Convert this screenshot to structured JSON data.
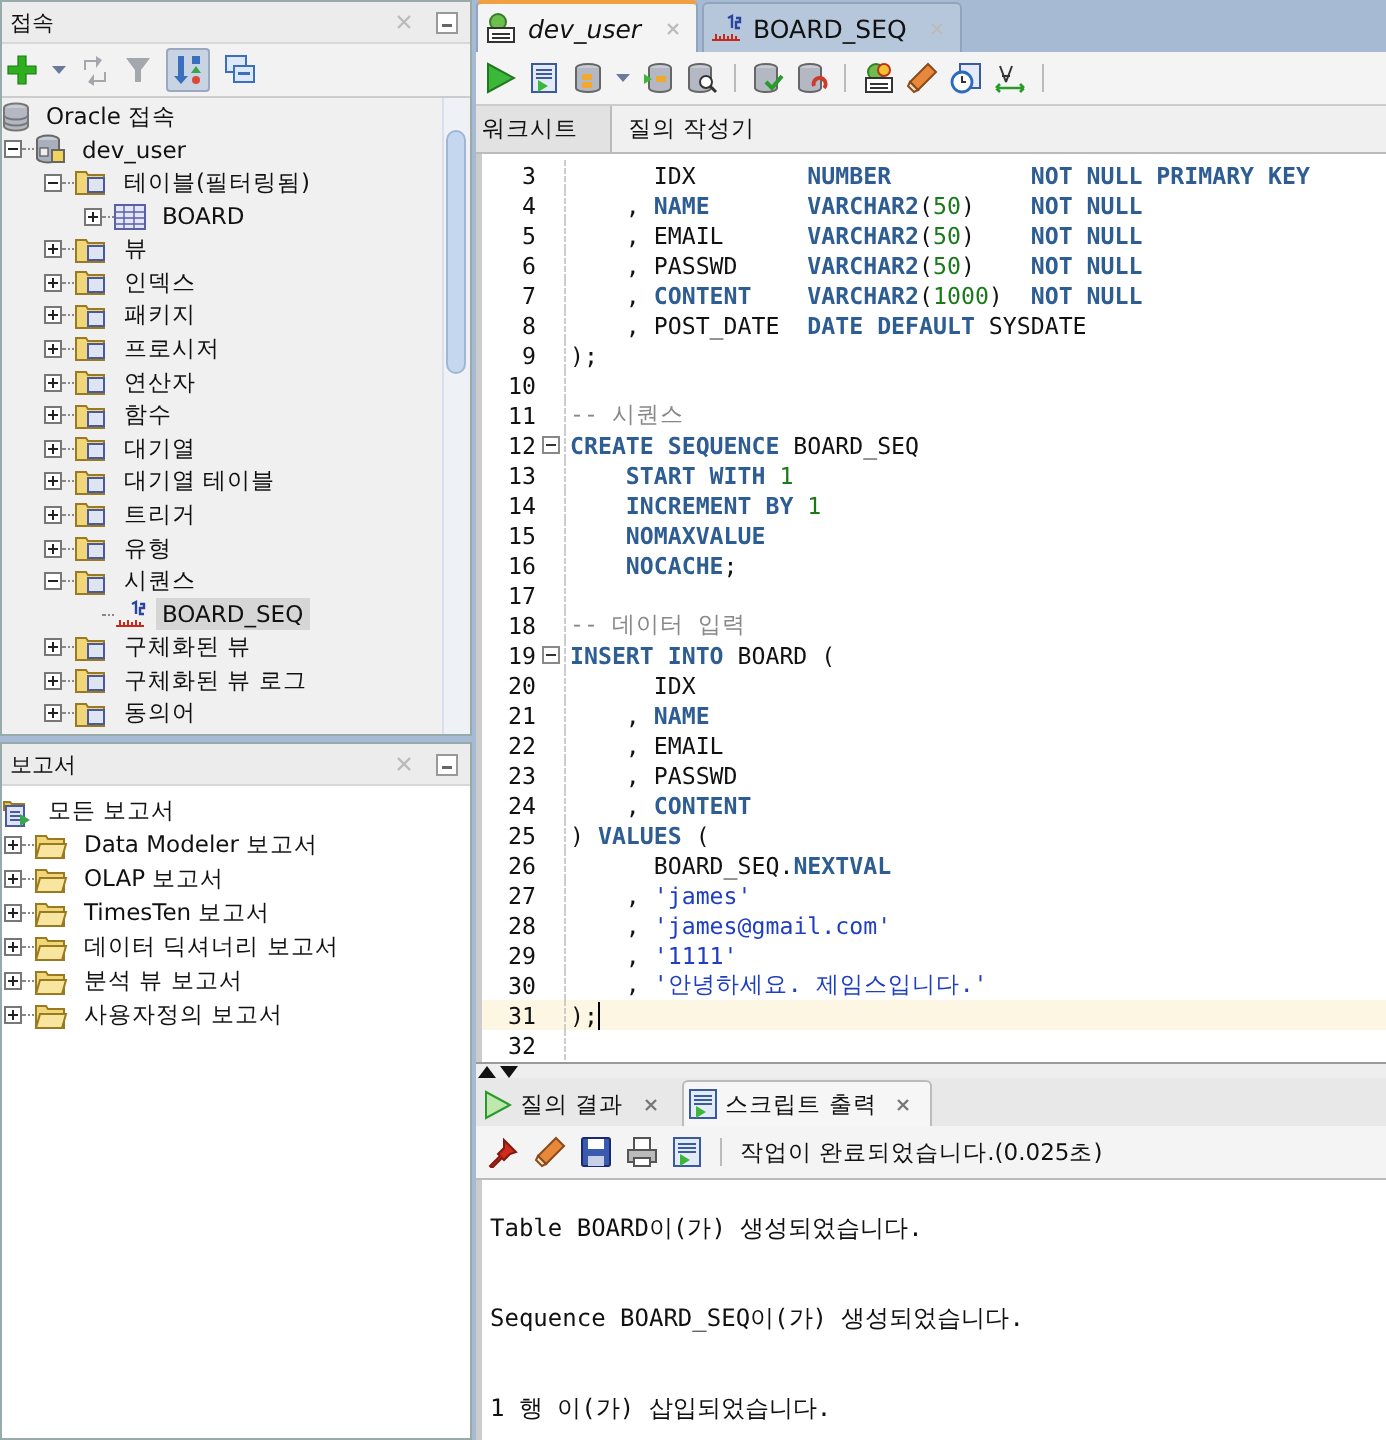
{
  "connections_panel": {
    "title": "접속",
    "tree": [
      {
        "label": "Oracle 접속",
        "kind": "root",
        "selected": false,
        "children": [
          {
            "label": "dev_user",
            "kind": "connection",
            "expanded": true,
            "selected": false,
            "children": [
              {
                "label": "테이블(필터링됨)",
                "kind": "folder",
                "expanded": true,
                "selected": false,
                "children": [
                  {
                    "label": "BOARD",
                    "kind": "table",
                    "expanded": false,
                    "selected": false
                  }
                ]
              },
              {
                "label": "뷰",
                "kind": "folder",
                "expanded": false,
                "selected": false
              },
              {
                "label": "인덱스",
                "kind": "folder",
                "expanded": false,
                "selected": false
              },
              {
                "label": "패키지",
                "kind": "folder",
                "expanded": false,
                "selected": false
              },
              {
                "label": "프로시저",
                "kind": "folder",
                "expanded": false,
                "selected": false
              },
              {
                "label": "연산자",
                "kind": "folder",
                "expanded": false,
                "selected": false
              },
              {
                "label": "함수",
                "kind": "folder",
                "expanded": false,
                "selected": false
              },
              {
                "label": "대기열",
                "kind": "folder",
                "expanded": false,
                "selected": false
              },
              {
                "label": "대기열 테이블",
                "kind": "folder",
                "expanded": false,
                "selected": false
              },
              {
                "label": "트리거",
                "kind": "folder",
                "expanded": false,
                "selected": false
              },
              {
                "label": "유형",
                "kind": "folder",
                "expanded": false,
                "selected": false
              },
              {
                "label": "시퀀스",
                "kind": "folder",
                "expanded": true,
                "selected": false,
                "children": [
                  {
                    "label": "BOARD_SEQ",
                    "kind": "sequence",
                    "selected": true
                  }
                ]
              },
              {
                "label": "구체화된 뷰",
                "kind": "folder",
                "expanded": false,
                "selected": false
              },
              {
                "label": "구체화된 뷰 로그",
                "kind": "folder",
                "expanded": false,
                "selected": false
              },
              {
                "label": "동의어",
                "kind": "folder",
                "expanded": false,
                "selected": false
              }
            ]
          }
        ]
      }
    ]
  },
  "reports_panel": {
    "title": "보고서",
    "tree": [
      {
        "label": "모든 보고서",
        "kind": "reports-root",
        "selected": false,
        "children": [
          {
            "label": "Data Modeler 보고서",
            "kind": "report-folder",
            "expanded": false,
            "selected": false
          },
          {
            "label": "OLAP 보고서",
            "kind": "report-folder",
            "expanded": false,
            "selected": false
          },
          {
            "label": "TimesTen 보고서",
            "kind": "report-folder",
            "expanded": false,
            "selected": false
          },
          {
            "label": "데이터 딕셔너리 보고서",
            "kind": "report-folder",
            "expanded": false,
            "selected": false
          },
          {
            "label": "분석 뷰 보고서",
            "kind": "report-folder",
            "expanded": false,
            "selected": false
          },
          {
            "label": "사용자정의 보고서",
            "kind": "report-folder",
            "expanded": false,
            "selected": false
          }
        ]
      }
    ]
  },
  "editor_tabs": [
    {
      "label": "dev_user",
      "kind": "worksheet",
      "selected": true
    },
    {
      "label": "BOARD_SEQ",
      "kind": "sequence",
      "selected": false
    }
  ],
  "worksheet_tabs": [
    {
      "label": "워크시트",
      "selected": true
    },
    {
      "label": "질의 작성기",
      "selected": false
    }
  ],
  "code_lines": [
    {
      "number": "3",
      "foldable": false,
      "current": false,
      "tokens": [
        {
          "text": "      IDX        ",
          "kind": "plain"
        },
        {
          "text": "NUMBER          ",
          "kind": "kw"
        },
        {
          "text": "NOT NULL PRIMARY KEY",
          "kind": "kw"
        }
      ]
    },
    {
      "number": "4",
      "foldable": false,
      "current": false,
      "tokens": [
        {
          "text": "    , ",
          "kind": "plain"
        },
        {
          "text": "NAME       ",
          "kind": "kw"
        },
        {
          "text": "VARCHAR2",
          "kind": "kw"
        },
        {
          "text": "(",
          "kind": "plain"
        },
        {
          "text": "50",
          "kind": "num"
        },
        {
          "text": ")    ",
          "kind": "plain"
        },
        {
          "text": "NOT NULL",
          "kind": "kw"
        }
      ]
    },
    {
      "number": "5",
      "foldable": false,
      "current": false,
      "tokens": [
        {
          "text": "    , EMAIL      ",
          "kind": "plain"
        },
        {
          "text": "VARCHAR2",
          "kind": "kw"
        },
        {
          "text": "(",
          "kind": "plain"
        },
        {
          "text": "50",
          "kind": "num"
        },
        {
          "text": ")    ",
          "kind": "plain"
        },
        {
          "text": "NOT NULL",
          "kind": "kw"
        }
      ]
    },
    {
      "number": "6",
      "foldable": false,
      "current": false,
      "tokens": [
        {
          "text": "    , PASSWD     ",
          "kind": "plain"
        },
        {
          "text": "VARCHAR2",
          "kind": "kw"
        },
        {
          "text": "(",
          "kind": "plain"
        },
        {
          "text": "50",
          "kind": "num"
        },
        {
          "text": ")    ",
          "kind": "plain"
        },
        {
          "text": "NOT NULL",
          "kind": "kw"
        }
      ]
    },
    {
      "number": "7",
      "foldable": false,
      "current": false,
      "tokens": [
        {
          "text": "    , ",
          "kind": "plain"
        },
        {
          "text": "CONTENT    ",
          "kind": "kw"
        },
        {
          "text": "VARCHAR2",
          "kind": "kw"
        },
        {
          "text": "(",
          "kind": "plain"
        },
        {
          "text": "1000",
          "kind": "num"
        },
        {
          "text": ")  ",
          "kind": "plain"
        },
        {
          "text": "NOT NULL",
          "kind": "kw"
        }
      ]
    },
    {
      "number": "8",
      "foldable": false,
      "current": false,
      "tokens": [
        {
          "text": "    , POST_DATE  ",
          "kind": "plain"
        },
        {
          "text": "DATE DEFAULT",
          "kind": "kw"
        },
        {
          "text": " SYSDATE",
          "kind": "plain"
        }
      ]
    },
    {
      "number": "9",
      "foldable": false,
      "current": false,
      "tokens": [
        {
          "text": ");",
          "kind": "plain"
        }
      ]
    },
    {
      "number": "10",
      "foldable": false,
      "current": false
    },
    {
      "number": "11",
      "foldable": false,
      "current": false,
      "tokens": [
        {
          "text": "-- 시퀀스",
          "kind": "comment"
        }
      ]
    },
    {
      "number": "12",
      "foldable": true,
      "current": false,
      "tokens": [
        {
          "text": "CREATE SEQUENCE",
          "kind": "kw"
        },
        {
          "text": " BOARD_SEQ",
          "kind": "plain"
        }
      ]
    },
    {
      "number": "13",
      "foldable": false,
      "current": false,
      "tokens": [
        {
          "text": "    START WITH ",
          "kind": "kw"
        },
        {
          "text": "1",
          "kind": "num"
        }
      ]
    },
    {
      "number": "14",
      "foldable": false,
      "current": false,
      "tokens": [
        {
          "text": "    INCREMENT BY ",
          "kind": "kw"
        },
        {
          "text": "1",
          "kind": "num"
        }
      ]
    },
    {
      "number": "15",
      "foldable": false,
      "current": false,
      "tokens": [
        {
          "text": "    NOMAXVALUE",
          "kind": "kw"
        }
      ]
    },
    {
      "number": "16",
      "foldable": false,
      "current": false,
      "tokens": [
        {
          "text": "    NOCACHE",
          "kind": "kw"
        },
        {
          "text": ";",
          "kind": "plain"
        }
      ]
    },
    {
      "number": "17",
      "foldable": false,
      "current": false
    },
    {
      "number": "18",
      "foldable": false,
      "current": false,
      "tokens": [
        {
          "text": "-- 데이터 입력",
          "kind": "comment"
        }
      ]
    },
    {
      "number": "19",
      "foldable": true,
      "current": false,
      "tokens": [
        {
          "text": "INSERT INTO",
          "kind": "kw"
        },
        {
          "text": " BOARD (",
          "kind": "plain"
        }
      ]
    },
    {
      "number": "20",
      "foldable": false,
      "current": false,
      "tokens": [
        {
          "text": "      IDX",
          "kind": "plain"
        }
      ]
    },
    {
      "number": "21",
      "foldable": false,
      "current": false,
      "tokens": [
        {
          "text": "    , ",
          "kind": "plain"
        },
        {
          "text": "NAME",
          "kind": "kw"
        }
      ]
    },
    {
      "number": "22",
      "foldable": false,
      "current": false,
      "tokens": [
        {
          "text": "    , EMAIL",
          "kind": "plain"
        }
      ]
    },
    {
      "number": "23",
      "foldable": false,
      "current": false,
      "tokens": [
        {
          "text": "    , PASSWD",
          "kind": "plain"
        }
      ]
    },
    {
      "number": "24",
      "foldable": false,
      "current": false,
      "tokens": [
        {
          "text": "    , ",
          "kind": "plain"
        },
        {
          "text": "CONTENT",
          "kind": "kw"
        }
      ]
    },
    {
      "number": "25",
      "foldable": false,
      "current": false,
      "tokens": [
        {
          "text": ") ",
          "kind": "plain"
        },
        {
          "text": "VALUES",
          "kind": "kw"
        },
        {
          "text": " (",
          "kind": "plain"
        }
      ]
    },
    {
      "number": "26",
      "foldable": false,
      "current": false,
      "tokens": [
        {
          "text": "      BOARD_SEQ.",
          "kind": "plain"
        },
        {
          "text": "NEXTVAL",
          "kind": "kw"
        }
      ]
    },
    {
      "number": "27",
      "foldable": false,
      "current": false,
      "tokens": [
        {
          "text": "    , ",
          "kind": "plain"
        },
        {
          "text": "'james'",
          "kind": "string"
        }
      ]
    },
    {
      "number": "28",
      "foldable": false,
      "current": false,
      "tokens": [
        {
          "text": "    , ",
          "kind": "plain"
        },
        {
          "text": "'james@gmail.com'",
          "kind": "string"
        }
      ]
    },
    {
      "number": "29",
      "foldable": false,
      "current": false,
      "tokens": [
        {
          "text": "    , ",
          "kind": "plain"
        },
        {
          "text": "'1111'",
          "kind": "string"
        }
      ]
    },
    {
      "number": "30",
      "foldable": false,
      "current": false,
      "tokens": [
        {
          "text": "    , ",
          "kind": "plain"
        },
        {
          "text": "'안녕하세요. 제임스입니다.'",
          "kind": "string"
        }
      ]
    },
    {
      "number": "31",
      "foldable": false,
      "current": true,
      "tokens": [
        {
          "text": ");",
          "kind": "plain"
        }
      ]
    },
    {
      "number": "32",
      "foldable": false,
      "current": false
    }
  ],
  "output_tabs": [
    {
      "label": "질의 결과",
      "kind": "results",
      "selected": false
    },
    {
      "label": "스크립트 출력",
      "kind": "script",
      "selected": true
    }
  ],
  "output_status": "작업이 완료되었습니다.(0.025초)",
  "output_lines": [
    "Table BOARD이(가) 생성되었습니다.",
    "Sequence BOARD_SEQ이(가) 생성되었습니다.",
    "1 행 이(가) 삽입되었습니다."
  ]
}
